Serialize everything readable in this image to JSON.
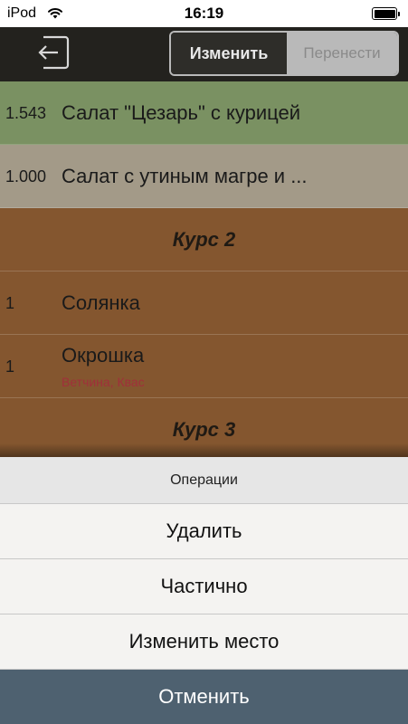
{
  "status_bar": {
    "carrier": "iPod",
    "time": "16:19"
  },
  "toolbar": {
    "back_icon": "logout-arrow-icon",
    "segments": [
      {
        "label": "Изменить",
        "active": true
      },
      {
        "label": "Перенести",
        "active": false
      }
    ]
  },
  "rows": [
    {
      "qty": "1.543",
      "name": "Салат \"Цезарь\" с курицей",
      "color": "#7a9162"
    },
    {
      "qty": "1.000",
      "name": "Салат с утиным магре и ...",
      "color": "#a39a88"
    },
    {
      "course": "Курс 2",
      "color": "#84562f"
    },
    {
      "qty": "1",
      "name": "Солянка",
      "color": "#84562f"
    },
    {
      "qty": "1",
      "name": "Окрошка",
      "modifiers": "Ветчина, Квас",
      "color": "#84562f"
    },
    {
      "course": "Курс 3",
      "color": "#84562f"
    }
  ],
  "action_sheet": {
    "title": "Операции",
    "actions": [
      "Удалить",
      "Частично",
      "Изменить место"
    ],
    "cancel": "Отменить"
  },
  "colors": {
    "toolbar_bg": "#23221e",
    "cancel_bg": "#4e6170",
    "modifier_text": "#a0303a"
  }
}
